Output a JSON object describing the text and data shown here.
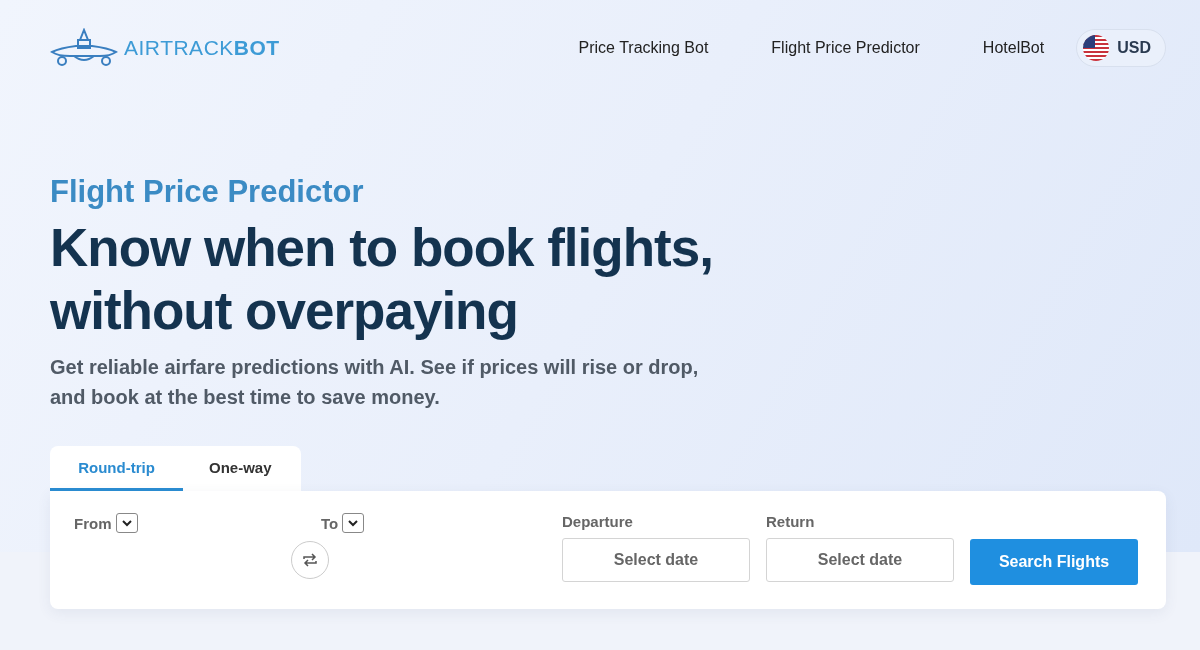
{
  "logo": {
    "text": "AIRTRACK**BOT**"
  },
  "nav": {
    "links": [
      "Price Tracking Bot",
      "Flight Price Predictor",
      "HotelBot"
    ],
    "currency": "USD"
  },
  "hero": {
    "eyebrow": "Flight Price Predictor",
    "title_lines": [
      "Know when to book flights,",
      "without overpaying"
    ],
    "subtitle_lines": [
      "Get reliable airfare predictions with AI. See if prices will rise or drop,",
      "and book at the best time to save money."
    ]
  },
  "search": {
    "tabs": [
      {
        "label": "Round-trip",
        "selected": true
      },
      {
        "label": "One-way",
        "selected": false
      }
    ],
    "from_label": "From",
    "to_label": "To",
    "date_fields": [
      {
        "label": "Departure",
        "placeholder": "Select date"
      },
      {
        "label": "Return",
        "placeholder": "Select date"
      }
    ],
    "button": "Search Flights"
  }
}
